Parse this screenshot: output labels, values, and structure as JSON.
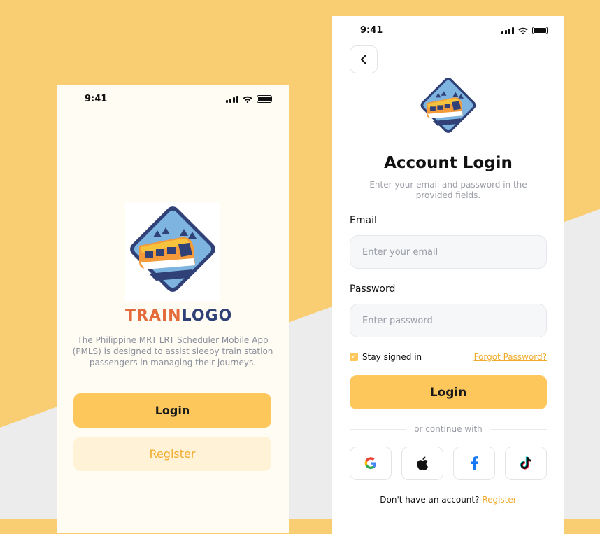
{
  "left_screen": {
    "status_time": "9:41",
    "brand_part1": "TRAIN",
    "brand_part2": "LOGO",
    "description": "The Philippine MRT LRT Scheduler Mobile App (PMLS) is designed to assist sleepy train station passengers in managing their journeys.",
    "login_label": "Login",
    "register_label": "Register"
  },
  "right_screen": {
    "status_time": "9:41",
    "title": "Account Login",
    "subtitle": "Enter your email and password in the provided fields.",
    "email_label": "Email",
    "email_placeholder": "Enter your email",
    "password_label": "Password",
    "password_placeholder": "Enter password",
    "stay_signed_in": "Stay signed in",
    "stay_signed_in_checked": true,
    "forgot_password": "Forgot Password?",
    "login_label": "Login",
    "continue_with": "or continue with",
    "social": [
      "google-icon",
      "apple-icon",
      "facebook-icon",
      "tiktok-icon"
    ],
    "footer_text": "Don't have an account?",
    "footer_link": "Register"
  },
  "colors": {
    "accent": "#fdc75c",
    "accent_text": "#f0ac2e",
    "brand_orange": "#e36b3c",
    "brand_navy": "#2f4177",
    "bg_yellow": "#f9cd72",
    "bg_gray": "#ececec"
  }
}
